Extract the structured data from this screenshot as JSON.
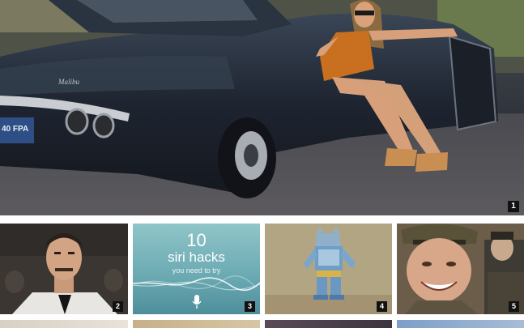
{
  "grid": {
    "hero": {
      "badge": "1",
      "plate_text": "40 FPA",
      "car_script": "Malibu"
    },
    "tiles": [
      {
        "badge": "2"
      },
      {
        "badge": "3",
        "siri_number": "10",
        "siri_title": "siri hacks",
        "siri_subtitle": "you need to try"
      },
      {
        "badge": "4"
      },
      {
        "badge": "5"
      }
    ]
  },
  "colors": {
    "badge_bg": "#111111",
    "badge_text": "#ffffff",
    "siri_panel": "#6aa9b2"
  }
}
